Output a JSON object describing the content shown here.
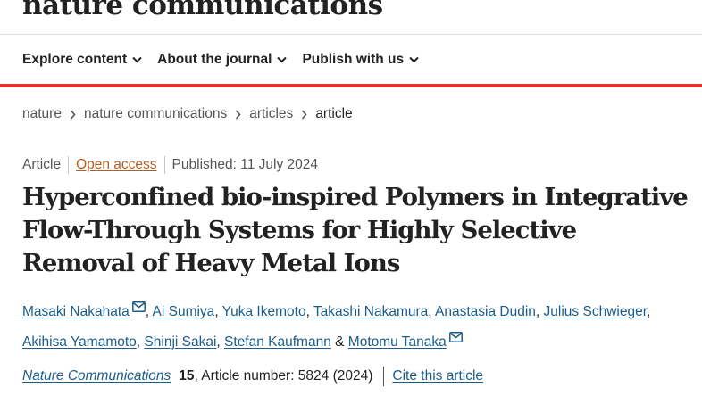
{
  "header": {
    "brand": "nature communications",
    "nav": [
      {
        "label": "Explore content"
      },
      {
        "label": "About the journal"
      },
      {
        "label": "Publish with us"
      }
    ]
  },
  "breadcrumb": [
    "nature",
    "nature communications",
    "articles",
    "article"
  ],
  "meta": {
    "type": "Article",
    "access": "Open access",
    "published": "Published: 11 July 2024"
  },
  "title": "Hyperconfined bio-inspired Polymers in Integrative Flow-Through Systems for Highly Selective Removal of Heavy Metal Ions",
  "authors": [
    "Masaki Nakahata",
    "Ai Sumiya",
    "Yuka Ikemoto",
    "Takashi Nakamura",
    "Anastasia Dudin",
    "Julius Schwieger",
    "Akihisa Yamamoto",
    "Shinji Sakai",
    "Stefan Kaufmann",
    "Motomu Tanaka"
  ],
  "citation": {
    "journal": "Nature Communications",
    "volume": "15",
    "article_number": ", Article number: 5824 (2024)",
    "cite_label": "Cite this article"
  },
  "colors": {
    "accent_bar": "#e0312c",
    "link": "#1b5c8a",
    "open_access": "#b85c1f"
  },
  "icons": {
    "nav_chevron": "chevron-down-icon",
    "breadcrumb_separator": "chevron-right-icon",
    "corresponding_author": "envelope-icon"
  }
}
